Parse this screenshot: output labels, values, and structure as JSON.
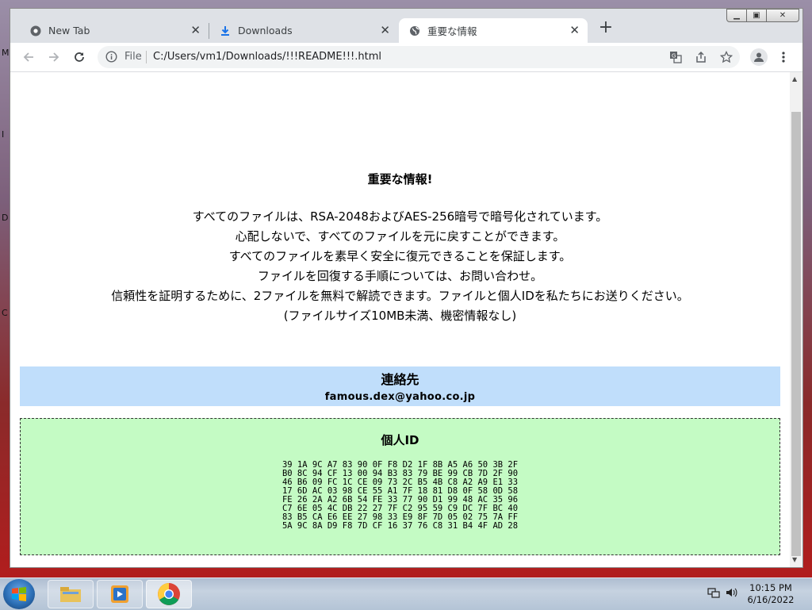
{
  "browser": {
    "tabs": [
      {
        "label": "New Tab",
        "icon": "chrome-icon"
      },
      {
        "label": "Downloads",
        "icon": "download-icon"
      },
      {
        "label": "重要な情報",
        "icon": "globe-icon",
        "active": true
      }
    ],
    "address": {
      "scheme": "File",
      "url": "C:/Users/vm1/Downloads/!!!README!!!.html"
    }
  },
  "page": {
    "title": "重要な情報!",
    "lines": [
      "すべてのファイルは、RSA-2048およびAES-256暗号で暗号化されています。",
      "心配しないで、すべてのファイルを元に戻すことができます。",
      "すべてのファイルを素早く安全に復元できることを保証します。",
      "ファイルを回復する手順については、お問い合わせ。",
      "信頼性を証明するために、2ファイルを無料で解読できます。ファイルと個人IDを私たちにお送りください。",
      "(ファイルサイズ10MB未満、機密情報なし)"
    ],
    "contact": {
      "heading": "連絡先",
      "email": "famous.dex@yahoo.co.jp",
      "color": "#c0defb"
    },
    "personal_id": {
      "heading": "個人ID",
      "color": "#c4fbc4",
      "rows": [
        "39 1A 9C A7 83 90 0F F8 D2 1F 8B A5 A6 50 3B 2F",
        "B0 8C 94 CF 13 00 94 B3 83 79 BE 99 CB 7D 2F 90",
        "46 B6 09 FC 1C CE 09 73 2C B5 4B C8 A2 A9 E1 33",
        "17 6D AC 03 98 CE 55 A1 7F 18 81 D8 0F 58 0D 58",
        "FE 26 2A A2 6B 54 FE 33 77 90 D1 99 48 AC 35 96",
        "C7 6E 05 4C DB 22 27 7F C2 95 59 C9 DC 7F BC 40",
        "83 B5 CA E6 EE 27 98 33 E9 8F 7D 05 02 75 7A FF",
        "5A 9C 8A D9 F8 7D CF 16 37 76 C8 31 B4 4F AD 28"
      ]
    }
  },
  "taskbar": {
    "time": "10:15 PM",
    "date": "6/16/2022",
    "apps": [
      "explorer-icon",
      "media-player-icon",
      "chrome-icon"
    ]
  },
  "desktop": {
    "edge_letters": [
      "M",
      "I",
      "D",
      "C"
    ]
  }
}
